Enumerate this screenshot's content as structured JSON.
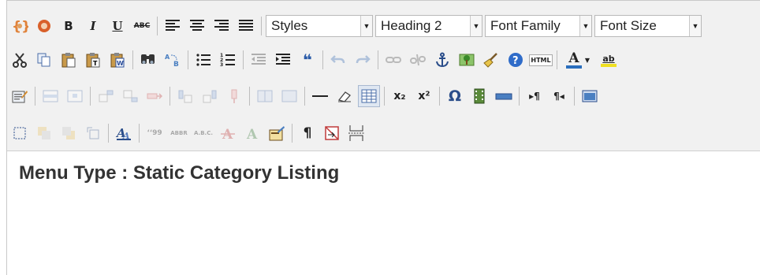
{
  "toolbar": {
    "row1": {
      "bold": "B",
      "italic": "I",
      "underline": "U",
      "strikethrough": "ABC",
      "styles_select": "Styles",
      "format_select": "Heading 2",
      "font_family_select": "Font Family",
      "font_size_select": "Font Size"
    },
    "row2": {
      "blockquote": "❝",
      "html_source": "HTML",
      "font_color_letter": "A",
      "highlight_letters": "ab"
    },
    "row3": {
      "subscript": "x₂",
      "superscript": "x²",
      "charmap": "Ω"
    },
    "row4": {
      "cite": "‘‘99",
      "abbr": "ABBR",
      "acronym": "A.B.C.",
      "pilcrow": "¶"
    }
  },
  "content": {
    "heading": "Menu Type : Static Category Listing"
  },
  "colors": {
    "toolbar_bg": "#f1f1f1",
    "font_color_bar": "#2a6ebd",
    "highlight_bar": "#f0e020",
    "heading_text": "#333333"
  }
}
